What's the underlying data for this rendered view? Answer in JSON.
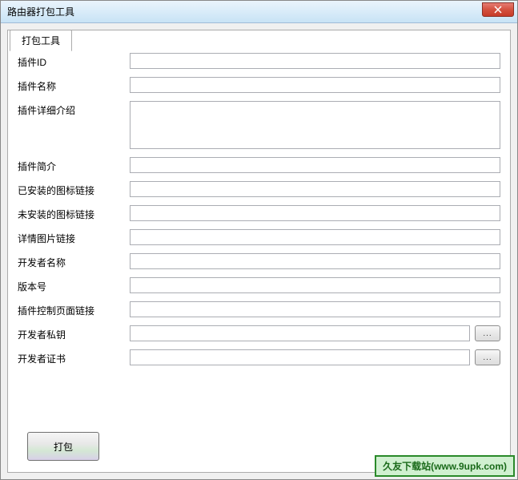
{
  "window": {
    "title": "路由器打包工具"
  },
  "tabs": [
    {
      "label": "打包工具"
    }
  ],
  "form": {
    "plugin_id": {
      "label": "插件ID",
      "value": ""
    },
    "plugin_name": {
      "label": "插件名称",
      "value": ""
    },
    "plugin_detail": {
      "label": "插件详细介绍",
      "value": ""
    },
    "plugin_brief": {
      "label": "插件简介",
      "value": ""
    },
    "installed_icon": {
      "label": "已安装的图标链接",
      "value": ""
    },
    "uninstalled_icon": {
      "label": "未安装的图标链接",
      "value": ""
    },
    "detail_image": {
      "label": "详情图片链接",
      "value": ""
    },
    "developer_name": {
      "label": "开发者名称",
      "value": ""
    },
    "version": {
      "label": "版本号",
      "value": ""
    },
    "control_page": {
      "label": "插件控制页面链接",
      "value": ""
    },
    "private_key": {
      "label": "开发者私钥",
      "value": ""
    },
    "certificate": {
      "label": "开发者证书",
      "value": ""
    }
  },
  "buttons": {
    "browse": "...",
    "pack": "打包"
  },
  "watermark": "久友下载站(www.9upk.com)"
}
